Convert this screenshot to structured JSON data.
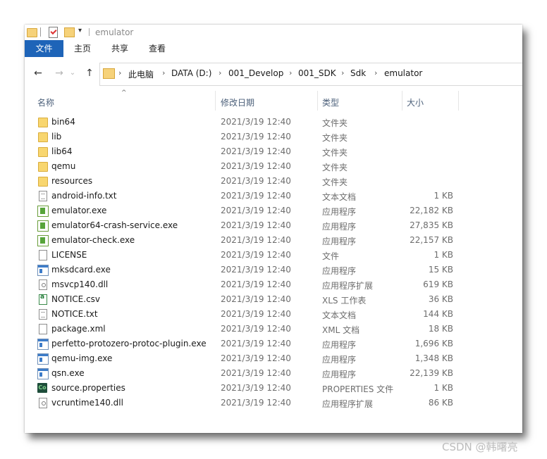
{
  "window": {
    "title": "emulator",
    "title_bar_dropdown": "▾"
  },
  "ribbon": {
    "tabs": [
      "文件",
      "主页",
      "共享",
      "查看"
    ]
  },
  "nav": {
    "back": "←",
    "forward": "→",
    "up": "↑"
  },
  "breadcrumb": {
    "separator": "›",
    "items": [
      "此电脑",
      "DATA (D:)",
      "001_Develop",
      "001_SDK",
      "Sdk",
      "emulator"
    ]
  },
  "columns": {
    "sort_indicator": "^",
    "name": "名称",
    "date": "修改日期",
    "type": "类型",
    "size": "大小"
  },
  "files": [
    {
      "name": "bin64",
      "date": "2021/3/19 12:40",
      "type": "文件夹",
      "size": "",
      "icon": "folder-icon"
    },
    {
      "name": "lib",
      "date": "2021/3/19 12:40",
      "type": "文件夹",
      "size": "",
      "icon": "folder-icon"
    },
    {
      "name": "lib64",
      "date": "2021/3/19 12:40",
      "type": "文件夹",
      "size": "",
      "icon": "folder-icon"
    },
    {
      "name": "qemu",
      "date": "2021/3/19 12:40",
      "type": "文件夹",
      "size": "",
      "icon": "folder-icon"
    },
    {
      "name": "resources",
      "date": "2021/3/19 12:40",
      "type": "文件夹",
      "size": "",
      "icon": "folder-icon"
    },
    {
      "name": "android-info.txt",
      "date": "2021/3/19 12:40",
      "type": "文本文档",
      "size": "1 KB",
      "icon": "text-file-icon"
    },
    {
      "name": "emulator.exe",
      "date": "2021/3/19 12:40",
      "type": "应用程序",
      "size": "22,182 KB",
      "icon": "emulator-exe-icon"
    },
    {
      "name": "emulator64-crash-service.exe",
      "date": "2021/3/19 12:40",
      "type": "应用程序",
      "size": "27,835 KB",
      "icon": "emulator-exe-icon"
    },
    {
      "name": "emulator-check.exe",
      "date": "2021/3/19 12:40",
      "type": "应用程序",
      "size": "22,157 KB",
      "icon": "emulator-exe-icon"
    },
    {
      "name": "LICENSE",
      "date": "2021/3/19 12:40",
      "type": "文件",
      "size": "1 KB",
      "icon": "blank-file-icon"
    },
    {
      "name": "mksdcard.exe",
      "date": "2021/3/19 12:40",
      "type": "应用程序",
      "size": "15 KB",
      "icon": "application-icon"
    },
    {
      "name": "msvcp140.dll",
      "date": "2021/3/19 12:40",
      "type": "应用程序扩展",
      "size": "619 KB",
      "icon": "dll-file-icon"
    },
    {
      "name": "NOTICE.csv",
      "date": "2021/3/19 12:40",
      "type": "XLS 工作表",
      "size": "36 KB",
      "icon": "csv-file-icon"
    },
    {
      "name": "NOTICE.txt",
      "date": "2021/3/19 12:40",
      "type": "文本文档",
      "size": "144 KB",
      "icon": "text-file-icon"
    },
    {
      "name": "package.xml",
      "date": "2021/3/19 12:40",
      "type": "XML 文档",
      "size": "18 KB",
      "icon": "blank-file-icon"
    },
    {
      "name": "perfetto-protozero-protoc-plugin.exe",
      "date": "2021/3/19 12:40",
      "type": "应用程序",
      "size": "1,696 KB",
      "icon": "application-icon"
    },
    {
      "name": "qemu-img.exe",
      "date": "2021/3/19 12:40",
      "type": "应用程序",
      "size": "1,348 KB",
      "icon": "application-icon"
    },
    {
      "name": "qsn.exe",
      "date": "2021/3/19 12:40",
      "type": "应用程序",
      "size": "22,139 KB",
      "icon": "application-icon"
    },
    {
      "name": "source.properties",
      "date": "2021/3/19 12:40",
      "type": "PROPERTIES 文件",
      "size": "1 KB",
      "icon": "properties-file-icon"
    },
    {
      "name": "vcruntime140.dll",
      "date": "2021/3/19 12:40",
      "type": "应用程序扩展",
      "size": "86 KB",
      "icon": "dll-file-icon"
    }
  ],
  "watermark": "CSDN @韩曙亮"
}
